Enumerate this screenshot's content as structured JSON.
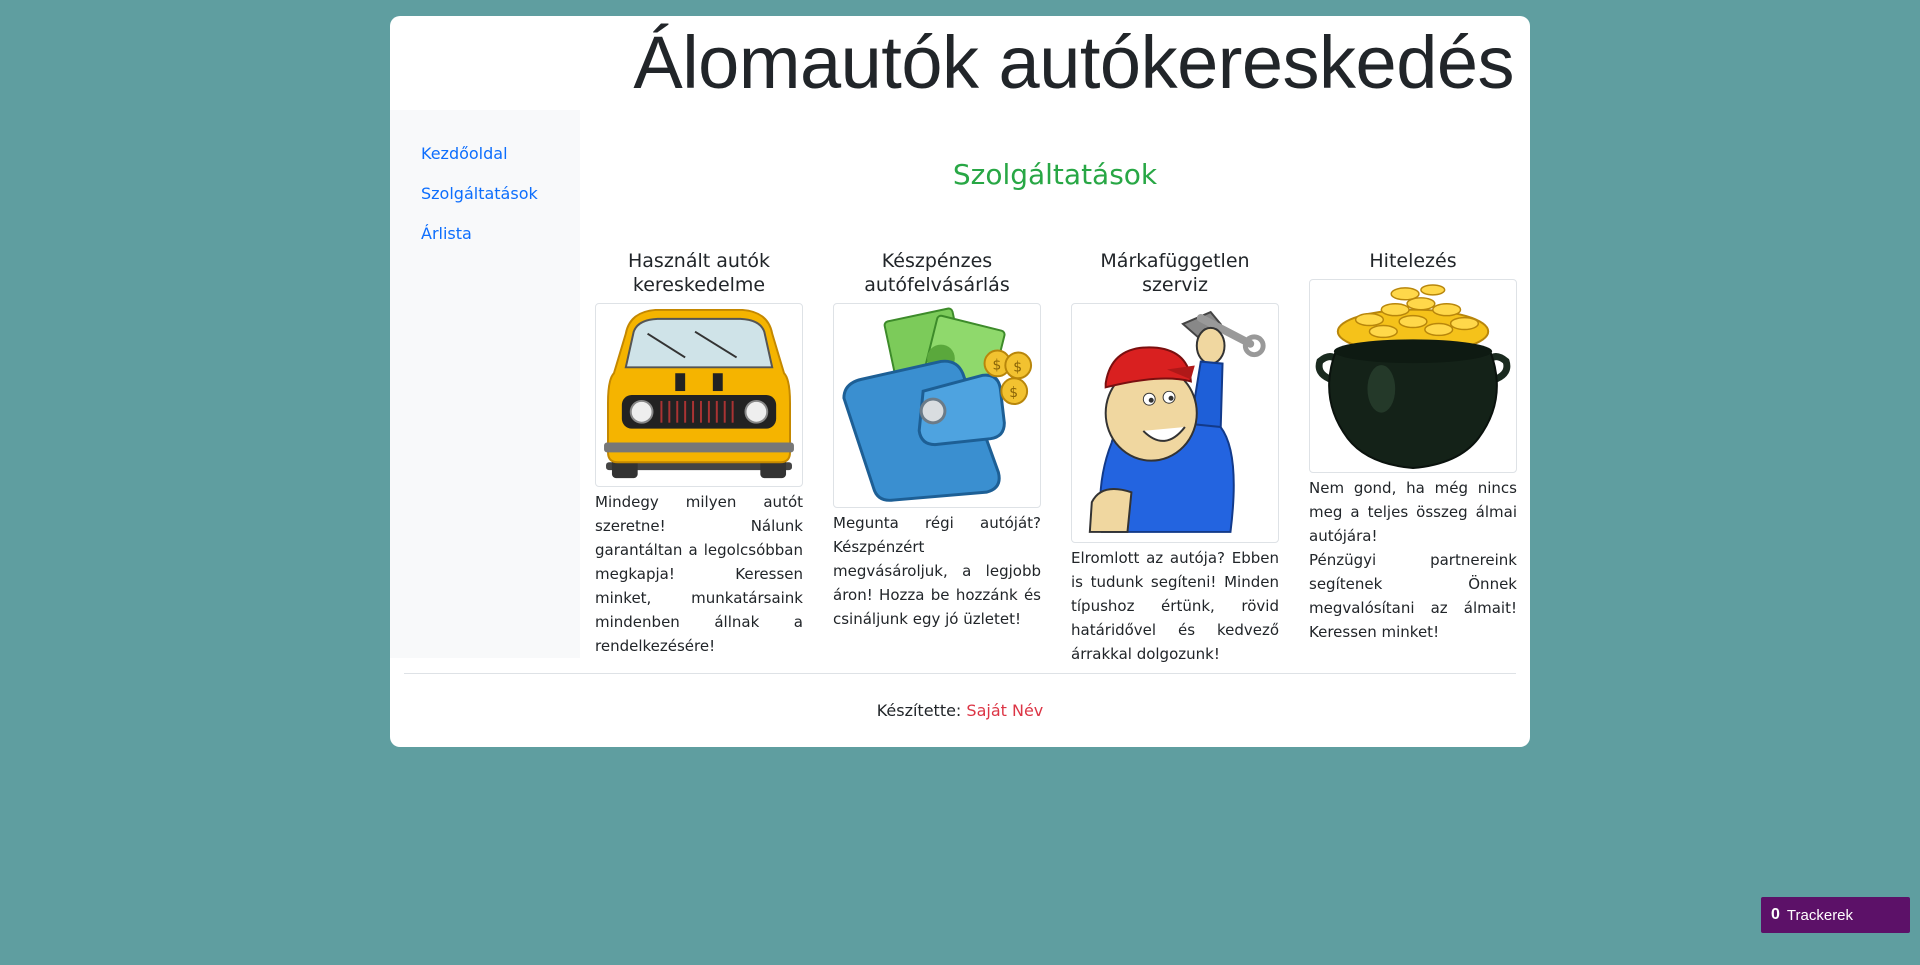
{
  "header": {
    "title": "Álomautók autókereskedés"
  },
  "sidebar": {
    "items": [
      {
        "label": "Kezdőoldal"
      },
      {
        "label": "Szolgáltatások"
      },
      {
        "label": "Árlista"
      }
    ]
  },
  "main": {
    "section_title": "Szolgáltatások",
    "services": [
      {
        "title": "Használt autók kereskedelme",
        "image": "yellow-car-icon",
        "text": "Mindegy milyen autót szeretne! Nálunk garantáltan a legolcsóbban megkapja! Keressen minket, munkatársaink mindenben állnak a rendelkezésére!"
      },
      {
        "title": "Készpénzes autófelvásárlás",
        "image": "wallet-money-icon",
        "text": "Megunta régi autóját? Készpénzért megvásároljuk, a legjobb áron! Hozza be hozzánk és csináljunk egy jó üzletet!"
      },
      {
        "title": "Márkafüggetlen szerviz",
        "image": "mechanic-wrench-icon",
        "text": "Elromlott az autója? Ebben is tudunk segíteni! Minden típushoz értünk, rövid határidővel és kedvező árrakkal dolgozunk!"
      },
      {
        "title": "Hitelezés",
        "image": "pot-of-gold-icon",
        "text1": "Nem gond, ha még nincs meg a teljes összeg álmai autójára!",
        "text2": "Pénzügyi partnereink segítenek Önnek megvalósítani az álmait! Keressen minket!"
      }
    ]
  },
  "footer": {
    "prefix": "Készítette:",
    "name": "Saját Név"
  },
  "tracker": {
    "count": "0",
    "label": "Trackerek"
  },
  "colors": {
    "background": "#5f9ea0",
    "section_title": "#28a745",
    "link": "#0d6efd",
    "footer_name": "#dc3545",
    "tracker": "#5c1168"
  }
}
